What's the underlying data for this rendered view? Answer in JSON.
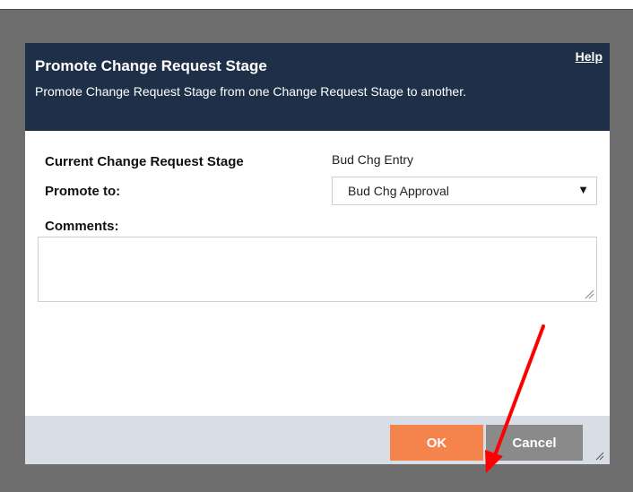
{
  "dialog": {
    "title": "Promote Change Request Stage",
    "subtitle": "Promote Change Request Stage from one Change Request Stage to another.",
    "help_label": "Help",
    "current_stage_label": "Current Change Request Stage",
    "current_stage_value": "Bud Chg Entry",
    "promote_to_label": "Promote to:",
    "promote_to_value": "Bud Chg Approval",
    "comments_label": "Comments:",
    "comments_value": ""
  },
  "footer": {
    "ok_label": "OK",
    "cancel_label": "Cancel"
  },
  "icons": {
    "dropdown": "caret-down-icon",
    "resize": "resize-grip-icon",
    "annotation": "arrow-annotation"
  },
  "colors": {
    "header_bg": "#1e3048",
    "ok_button": "#f5844c",
    "cancel_button": "#8a8a8a",
    "footer_bg": "#d8dde6",
    "annotation_arrow": "#ff0000",
    "overlay": "#6e6e6e"
  }
}
